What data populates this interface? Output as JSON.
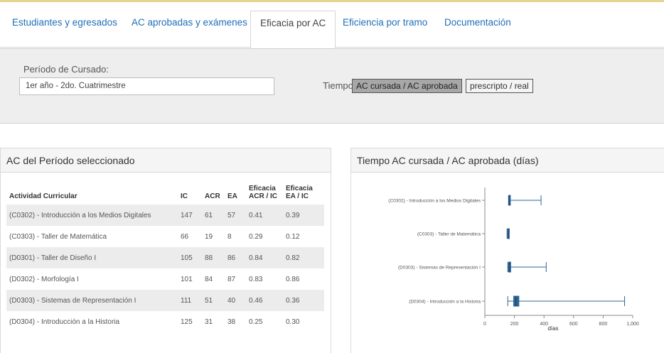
{
  "tabs": [
    {
      "label": "Estudiantes y egresados",
      "active": false
    },
    {
      "label": "AC aprobadas y exámenes",
      "active": false
    },
    {
      "label": "Eficacia por AC",
      "active": true
    },
    {
      "label": "Eficiencia por tramo",
      "active": false
    },
    {
      "label": "Documentación",
      "active": false
    }
  ],
  "filter": {
    "period_label": "Período de Cursado:",
    "period_value": "1er año - 2do. Cuatrimestre",
    "tiempo_label": "Tiempo:",
    "options": [
      {
        "label": "AC cursada / AC aprobada",
        "selected": true
      },
      {
        "label": "prescripto / real",
        "selected": false
      }
    ]
  },
  "left_panel": {
    "title": "AC del Período seleccionado",
    "columns": [
      "Actividad Curricular",
      "IC",
      "ACR",
      "EA",
      "Eficacia ACR / IC",
      "Eficacia EA / IC"
    ],
    "rows": [
      [
        "(C0302) - Introducción a los Medios Digitales",
        "147",
        "61",
        "57",
        "0.41",
        "0.39"
      ],
      [
        "(C0303) - Taller de Matemática",
        "66",
        "19",
        "8",
        "0.29",
        "0.12"
      ],
      [
        "(D0301) - Taller de Diseño I",
        "105",
        "88",
        "86",
        "0.84",
        "0.82"
      ],
      [
        "(D0302) - Morfología I",
        "101",
        "84",
        "87",
        "0.83",
        "0.86"
      ],
      [
        "(D0303) - Sistemas de Representación I",
        "111",
        "51",
        "40",
        "0.46",
        "0.36"
      ],
      [
        "(D0304) - Introducción a la Historia",
        "125",
        "31",
        "38",
        "0.25",
        "0.30"
      ]
    ]
  },
  "right_panel": {
    "title": "Tiempo AC cursada / AC aprobada (días)"
  },
  "chart_data": {
    "type": "boxplot",
    "orientation": "horizontal",
    "categories": [
      "(C0302) - Introducción a los Medios Digitales",
      "(C0303) - Taller de Matemática",
      "(D0303) - Sistemas de Representación I",
      "(D0304) - Introducción a la Historia"
    ],
    "boxes": [
      {
        "whisker_low": 160,
        "q1": 163,
        "median": 165,
        "q3": 167,
        "whisker_high": 380
      },
      {
        "whisker_low": 150,
        "q1": 155,
        "median": 158,
        "q3": 162,
        "whisker_high": 165
      },
      {
        "whisker_low": 155,
        "q1": 160,
        "median": 165,
        "q3": 175,
        "whisker_high": 415
      },
      {
        "whisker_low": 155,
        "q1": 195,
        "median": 210,
        "q3": 230,
        "whisker_high": 945
      }
    ],
    "xlabel": "días",
    "xlim": [
      0,
      1000
    ],
    "xticks": [
      0,
      200,
      400,
      600,
      800,
      1000
    ],
    "xtick_labels": [
      "0",
      "200",
      "400",
      "600",
      "800",
      "1,000"
    ],
    "box_color": "#2f6496",
    "grid": false
  },
  "colors": {
    "link": "#1f6fb7",
    "filter_bg": "#eeeeee",
    "row_shade": "#ececec",
    "accent_line": "#e6d48f"
  }
}
